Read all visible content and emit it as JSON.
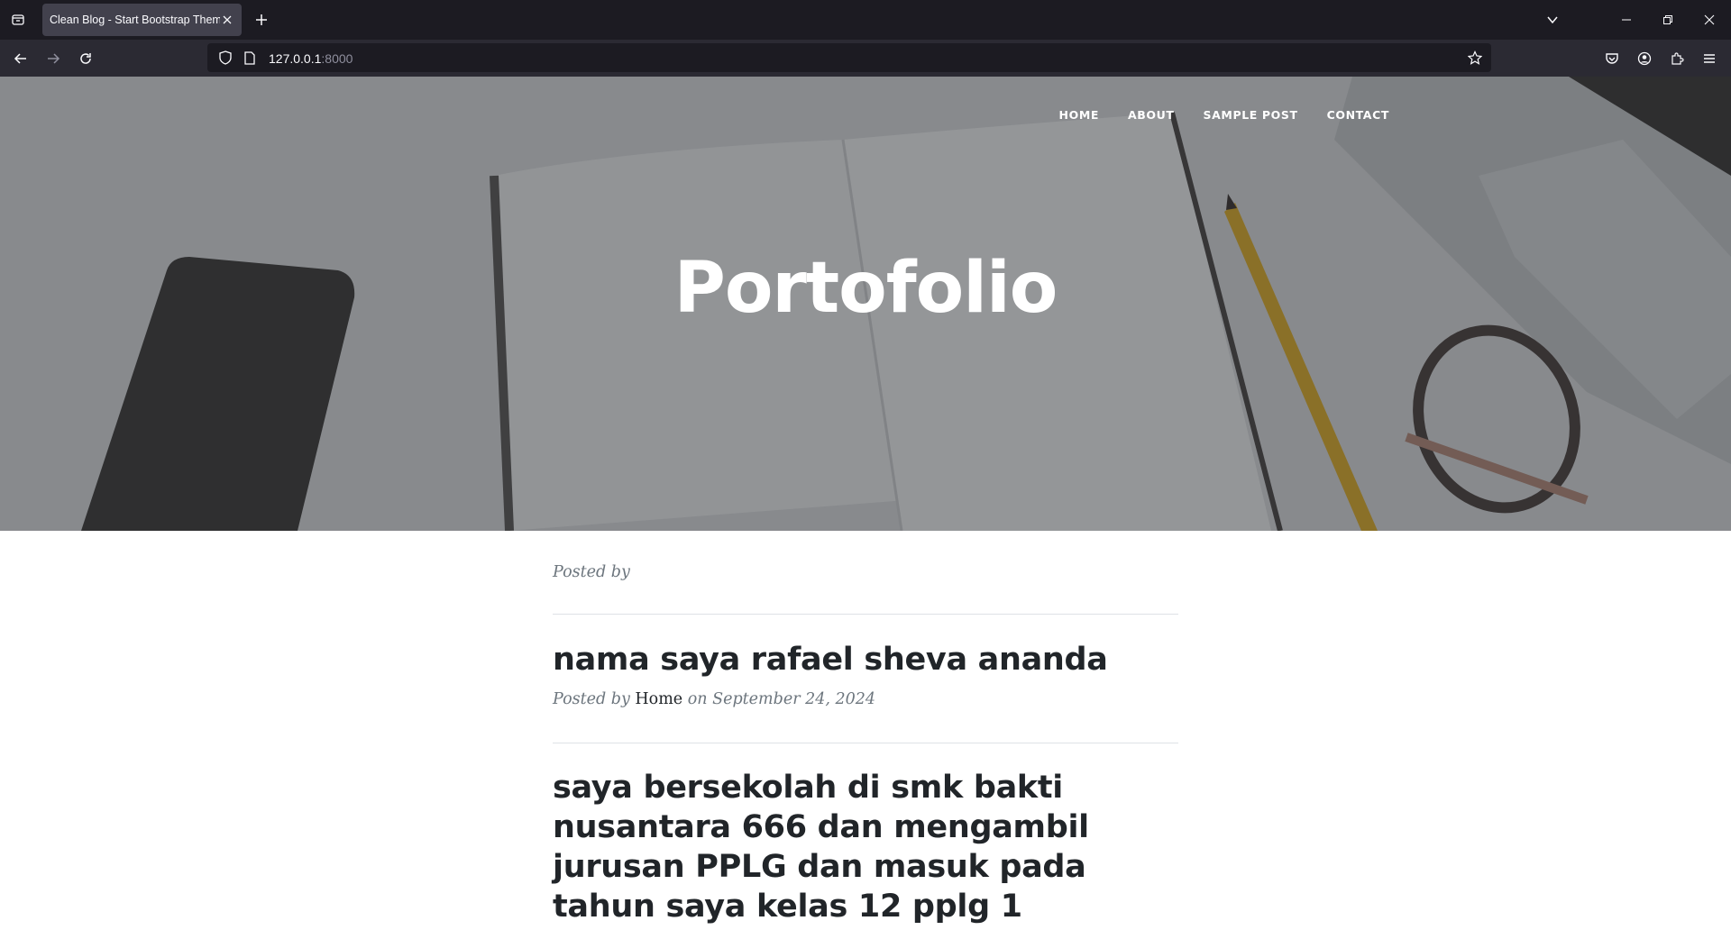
{
  "browser": {
    "tab_title": "Clean Blog - Start Bootstrap Theme",
    "url_host": "127.0.0.1",
    "url_port": ":8000"
  },
  "site": {
    "nav": [
      {
        "label": "HOME"
      },
      {
        "label": "ABOUT"
      },
      {
        "label": "SAMPLE POST"
      },
      {
        "label": "CONTACT"
      }
    ],
    "hero_title": "Portofolio"
  },
  "posts": {
    "first_meta": "Posted by",
    "items": [
      {
        "title": "nama saya rafael sheva ananda",
        "meta_prefix": "Posted by",
        "author": "Home",
        "meta_suffix": "on September 24, 2024"
      },
      {
        "title": "saya bersekolah di smk bakti nusantara 666 dan mengambil jurusan PPLG dan masuk pada tahun saya kelas 12 pplg 1"
      }
    ]
  }
}
